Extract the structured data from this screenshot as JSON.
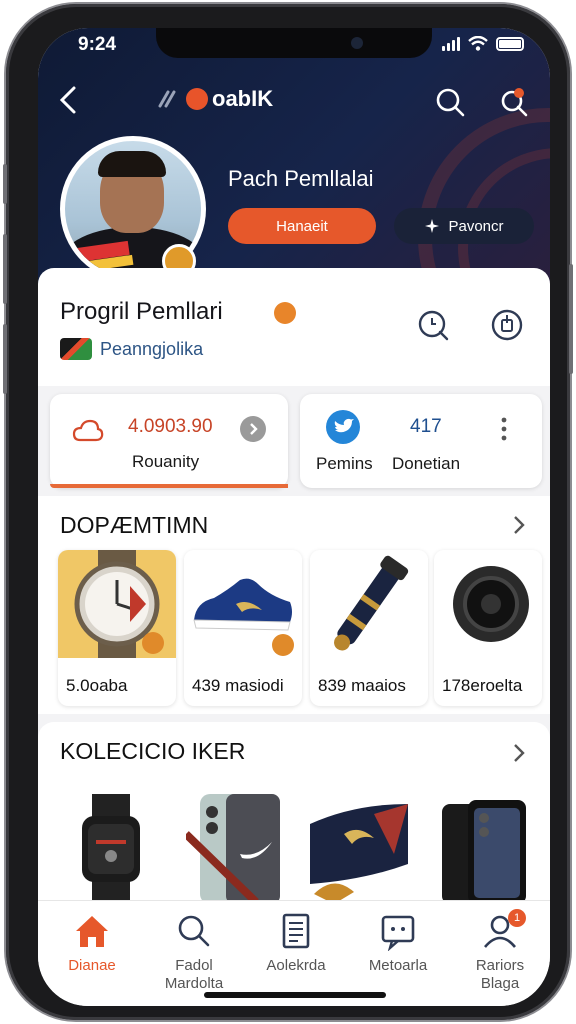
{
  "status": {
    "time": "9:24"
  },
  "header": {
    "brand": "oabIK"
  },
  "hero": {
    "name": "Pach Pemllalai",
    "primary_button": "Hanaeit",
    "secondary_button": "Pavoncr"
  },
  "profile": {
    "title": "Progril Pemllari",
    "subtitle": "Peanngjolika"
  },
  "stats": [
    {
      "value": "4.0903.90",
      "label": "Rouanity"
    },
    {
      "value": "417",
      "label_left": "Pemins",
      "label_right": "Donetian"
    }
  ],
  "section1": {
    "title": "DOPÆMTIMN",
    "products": [
      {
        "label": "5.0oaba",
        "icon": "watch-icon"
      },
      {
        "label": "439 masiodi",
        "icon": "sneaker-icon"
      },
      {
        "label": "839 maaios",
        "icon": "flashlight-icon"
      },
      {
        "label": "178eroelta",
        "icon": "speaker-icon"
      }
    ]
  },
  "section2": {
    "title": "KOLECICIO IKER",
    "items": [
      "smartwatch-icon",
      "phone-case-icon",
      "scarf-icon",
      "smartphone-icon"
    ]
  },
  "tabs": [
    {
      "label": "Dianae",
      "icon": "home-icon",
      "active": true
    },
    {
      "label": "Fadol\nMardolta",
      "icon": "search-icon"
    },
    {
      "label": "Aolekrda",
      "icon": "document-icon"
    },
    {
      "label": "Metoarla",
      "icon": "message-icon"
    },
    {
      "label": "Rariors\nBlaga",
      "icon": "profile-icon",
      "badge": "1"
    }
  ],
  "colors": {
    "accent": "#e6582b",
    "hero_bg": "#0f1a35",
    "link": "#2d5585"
  }
}
